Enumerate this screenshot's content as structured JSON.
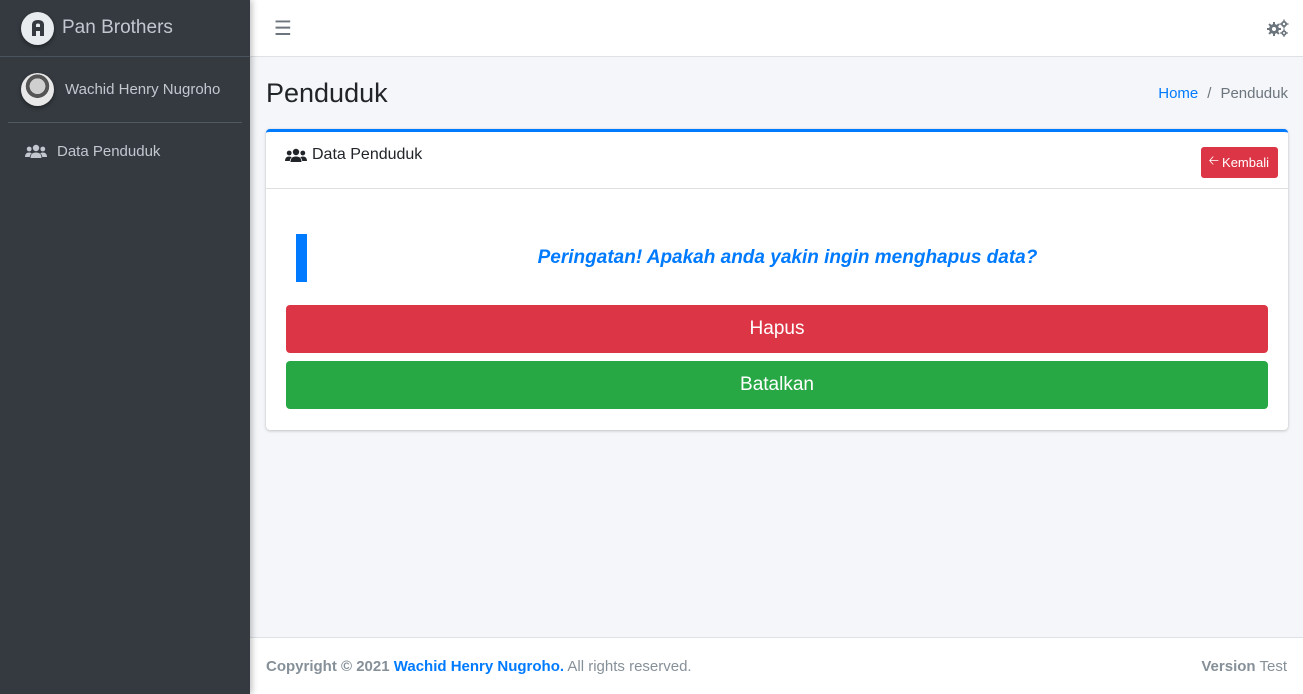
{
  "sidebar": {
    "brand": "Pan Brothers",
    "user_name": "Wachid Henry Nugroho",
    "items": [
      {
        "label": "Data Penduduk",
        "icon": "users-icon"
      }
    ]
  },
  "navbar": {
    "menu_icon": "hamburger-icon",
    "settings_icon": "gears-icon"
  },
  "header": {
    "title": "Penduduk",
    "breadcrumb": {
      "home": "Home",
      "separator": "/",
      "current": "Penduduk"
    }
  },
  "card": {
    "title": "Data Penduduk",
    "back_label": "Kembali",
    "warning": "Peringatan! Apakah anda yakin ingin menghapus data?",
    "delete_label": "Hapus",
    "cancel_label": "Batalkan"
  },
  "footer": {
    "copyright_prefix": "Copyright © 2021",
    "author": "Wachid Henry Nugroho.",
    "rights": "All rights reserved.",
    "version_label": "Version",
    "version_value": "Test"
  },
  "colors": {
    "primary": "#007bff",
    "danger": "#dc3545",
    "success": "#28a745",
    "sidebar": "#343a40"
  }
}
